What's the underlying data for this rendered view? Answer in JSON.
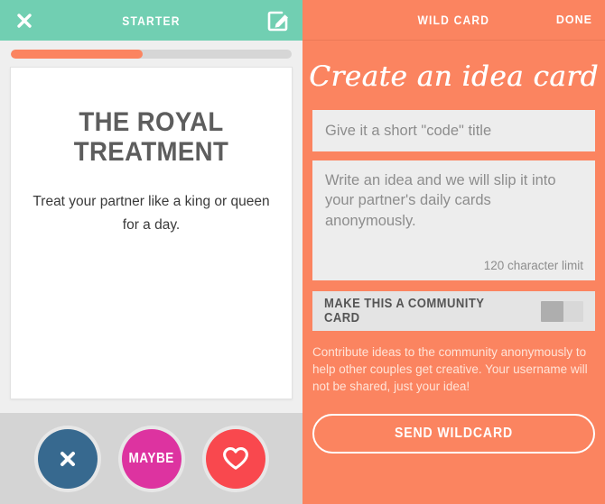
{
  "colors": {
    "teal": "#71CFB2",
    "orange": "#FB8460",
    "blue": "#37698F",
    "magenta": "#DD33A0",
    "red": "#F9484E",
    "grey_footer": "#D4D4D4",
    "field_grey": "#EDEDED"
  },
  "left_panel": {
    "header": {
      "title": "STARTER",
      "close_icon": "close-x-icon",
      "edit_icon": "edit-compose-icon"
    },
    "progress": {
      "percent": 47
    },
    "card": {
      "title": "THE ROYAL TREATMENT",
      "description": "Treat your partner like a king or queen for a day."
    },
    "actions": [
      {
        "name": "nope",
        "icon": "close-x-icon",
        "label": "",
        "color": "#37698F"
      },
      {
        "name": "maybe",
        "icon": "",
        "label": "MAYBE",
        "color": "#DD33A0"
      },
      {
        "name": "love",
        "icon": "heart-outline-icon",
        "label": "",
        "color": "#F9484E"
      }
    ]
  },
  "right_panel": {
    "header": {
      "title": "WILD CARD",
      "done_label": "DONE"
    },
    "script_title": "Create an idea card",
    "code_input": {
      "value": "",
      "placeholder": "Give it a short \"code\" title"
    },
    "idea_textarea": {
      "value": "",
      "placeholder": "Write an idea and we will slip it into your partner's daily cards anonymously.",
      "char_limit_label": "120 character limit"
    },
    "community_toggle": {
      "label": "MAKE THIS A COMMUNITY CARD",
      "state": "off"
    },
    "community_description": "Contribute ideas to the community anonymously to help other couples get creative. Your username will not be shared, just your idea!",
    "send_button": {
      "label": "SEND WILDCARD"
    }
  }
}
